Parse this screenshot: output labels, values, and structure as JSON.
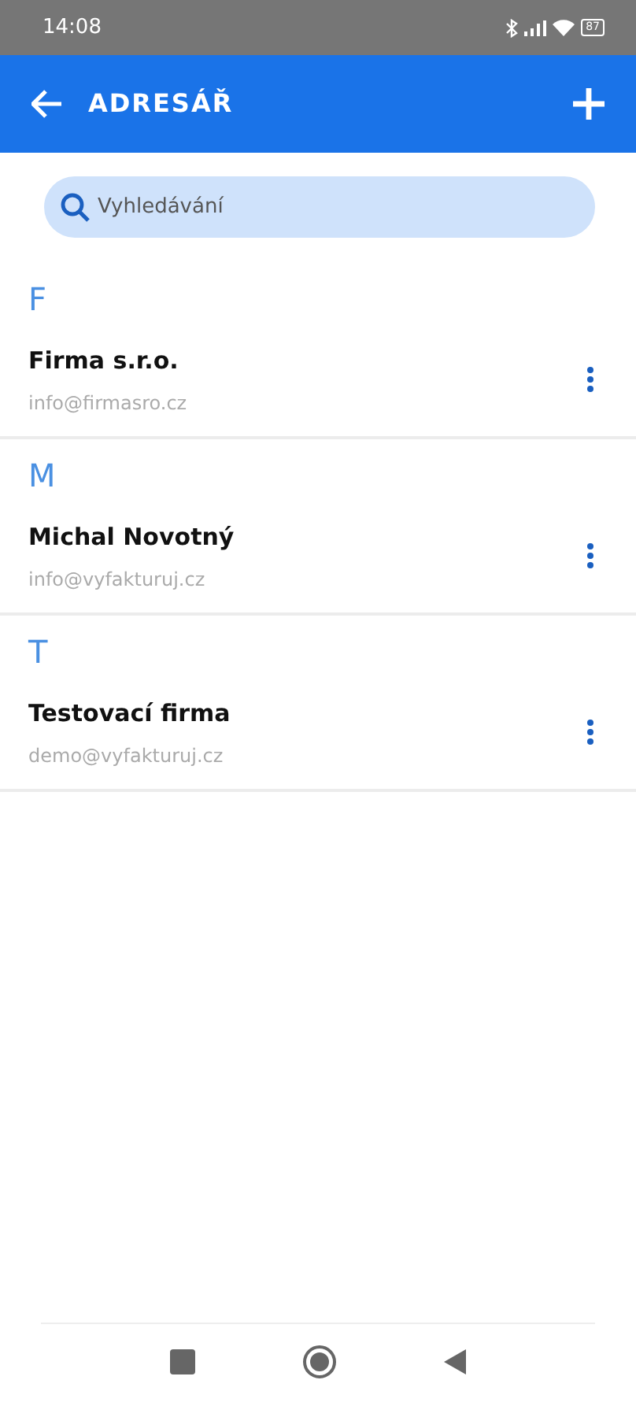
{
  "status_bar": {
    "time": "14:08",
    "battery": "87"
  },
  "app_bar": {
    "title": "ADRESÁŘ"
  },
  "search": {
    "placeholder": "Vyhledávání"
  },
  "sections": [
    {
      "letter": "F",
      "contacts": [
        {
          "name": "Firma s.r.o.",
          "email": "info@firmasro.cz"
        }
      ]
    },
    {
      "letter": "M",
      "contacts": [
        {
          "name": "Michal Novotný",
          "email": "info@vyfakturuj.cz"
        }
      ]
    },
    {
      "letter": "T",
      "contacts": [
        {
          "name": "Testovací firma",
          "email": "demo@vyfakturuj.cz"
        }
      ]
    }
  ]
}
